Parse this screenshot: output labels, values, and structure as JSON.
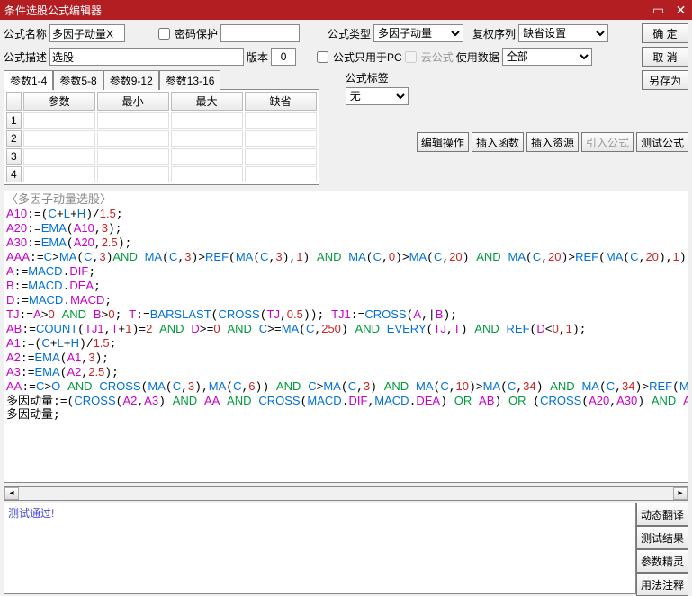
{
  "title": "条件选股公式编辑器",
  "labels": {
    "name": "公式名称",
    "pwd": "密码保护",
    "type": "公式类型",
    "fqxl": "复权序列",
    "desc": "公式描述",
    "ver": "版本",
    "pconly": "公式只用于PC",
    "cloud": "云公式",
    "usedata": "使用数据",
    "tag": "公式标签"
  },
  "values": {
    "name": "多因子动量X",
    "desc": "选股",
    "ver": "0",
    "tag": "无"
  },
  "selects": {
    "type": "多因子动量",
    "fqxl": "缺省设置",
    "usedata": "全部"
  },
  "buttons": {
    "ok": "确 定",
    "cancel": "取 消",
    "saveas": "另存为",
    "editop": "编辑操作",
    "insfn": "插入函数",
    "insres": "插入资源",
    "import": "引入公式",
    "test": "测试公式",
    "dtfy": "动态翻译",
    "csjg": "测试结果",
    "csjl": "参数精灵",
    "yfzs": "用法注释"
  },
  "tabs": [
    "参数1-4",
    "参数5-8",
    "参数9-12",
    "参数13-16"
  ],
  "paramHeaders": [
    "参数",
    "最小",
    "最大",
    "缺省"
  ],
  "paramRows": [
    "1",
    "2",
    "3",
    "4"
  ],
  "editorTitle": "〈多因子动量选股〉",
  "status": "测试通过!"
}
